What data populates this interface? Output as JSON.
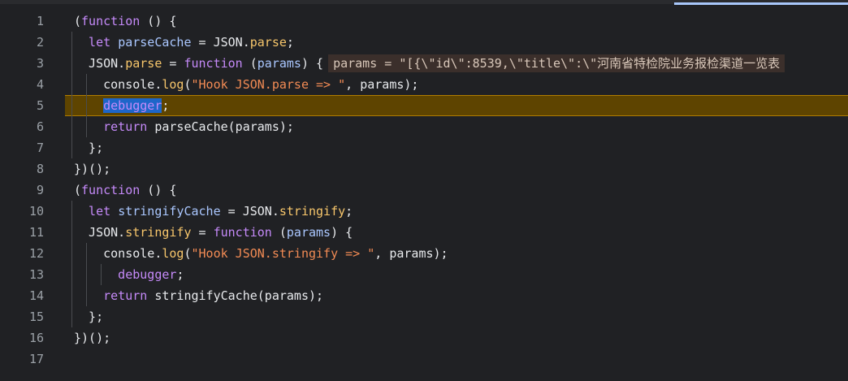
{
  "editor": {
    "line_numbers": [
      "1",
      "2",
      "3",
      "4",
      "5",
      "6",
      "7",
      "8",
      "9",
      "10",
      "11",
      "12",
      "13",
      "14",
      "15",
      "16",
      "17"
    ],
    "lines": [
      [
        [
          "pn",
          "("
        ],
        [
          "kw",
          "function"
        ],
        [
          "pn",
          " () {"
        ]
      ],
      [
        [
          "kw",
          "  let "
        ],
        [
          "pr",
          "parseCache"
        ],
        [
          "pn",
          " = JSON."
        ],
        [
          "prop",
          "parse"
        ],
        [
          "pn",
          ";"
        ]
      ],
      [
        [
          "pn",
          "  JSON."
        ],
        [
          "prop",
          "parse"
        ],
        [
          "pn",
          " = "
        ],
        [
          "kw",
          "function"
        ],
        [
          "pn",
          " ("
        ],
        [
          "pr",
          "params"
        ],
        [
          "pn",
          ") {"
        ]
      ],
      [
        [
          "pn",
          "    console."
        ],
        [
          "prop",
          "log"
        ],
        [
          "pn",
          "("
        ],
        [
          "str",
          "\"Hook JSON.parse => \""
        ],
        [
          "pn",
          ", params);"
        ]
      ],
      [
        [
          "dbg",
          "    debugger"
        ],
        [
          "pn",
          ";"
        ]
      ],
      [
        [
          "kw",
          "    return"
        ],
        [
          "pn",
          " parseCache(params);"
        ]
      ],
      [
        [
          "pn",
          "  };"
        ]
      ],
      [
        [
          "pn",
          "})();"
        ]
      ],
      [
        [
          "pn",
          "("
        ],
        [
          "kw",
          "function"
        ],
        [
          "pn",
          " () {"
        ]
      ],
      [
        [
          "kw",
          "  let "
        ],
        [
          "pr",
          "stringifyCache"
        ],
        [
          "pn",
          " = JSON."
        ],
        [
          "prop",
          "stringify"
        ],
        [
          "pn",
          ";"
        ]
      ],
      [
        [
          "pn",
          "  JSON."
        ],
        [
          "prop",
          "stringify"
        ],
        [
          "pn",
          " = "
        ],
        [
          "kw",
          "function"
        ],
        [
          "pn",
          " ("
        ],
        [
          "pr",
          "params"
        ],
        [
          "pn",
          ") {"
        ]
      ],
      [
        [
          "pn",
          "    console."
        ],
        [
          "prop",
          "log"
        ],
        [
          "pn",
          "("
        ],
        [
          "str",
          "\"Hook JSON.stringify => \""
        ],
        [
          "pn",
          ", params);"
        ]
      ],
      [
        [
          "kw",
          "      debugger"
        ],
        [
          "pn",
          ";"
        ]
      ],
      [
        [
          "kw",
          "    return"
        ],
        [
          "pn",
          " stringifyCache(params);"
        ]
      ],
      [
        [
          "pn",
          "  };"
        ]
      ],
      [
        [
          "pn",
          "})();"
        ]
      ],
      [
        [
          "pn",
          ""
        ]
      ]
    ],
    "inline_value": "params = \"[{\\\"id\\\":8539,\\\"title\\\":\\\"河南省特检院业务报检渠道一览表",
    "paused_line": 5
  },
  "colors": {
    "background": "#202124",
    "paused_line_bg": "#5e4400",
    "keyword": "#c58af9",
    "string": "#f28b54",
    "property": "#f7c66b"
  }
}
